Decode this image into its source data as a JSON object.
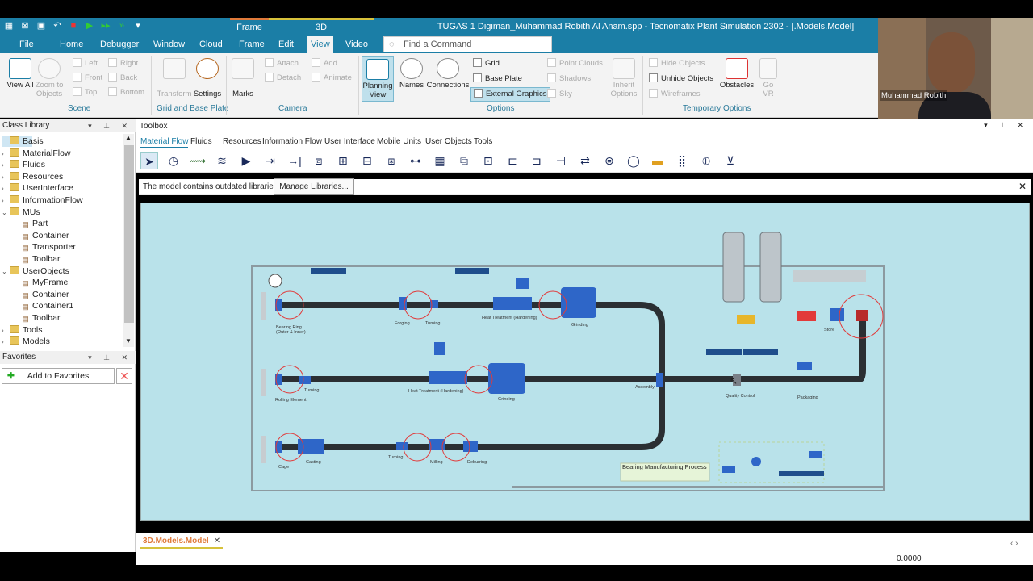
{
  "app": {
    "title": "TUGAS 1 Digiman_Muhammad Robith Al Anam.spp - Tecnomatix Plant Simulation 2302 - [.Models.Model]",
    "context_tabs": [
      "Frame",
      "3D"
    ]
  },
  "menu": [
    "File",
    "Home",
    "Debugger",
    "Window",
    "Cloud",
    "Frame",
    "Edit",
    "View",
    "Video"
  ],
  "active_menu": "View",
  "search": {
    "placeholder": "Find a Command"
  },
  "ribbon": {
    "scene": {
      "label": "Scene",
      "view_all": "View All",
      "zoom_to": "Zoom to Objects",
      "left": "Left",
      "front": "Front",
      "top": "Top",
      "right": "Right",
      "back": "Back",
      "bottom": "Bottom"
    },
    "grid_base": {
      "label": "Grid and Base Plate",
      "transform": "Transform",
      "settings": "Settings"
    },
    "camera": {
      "label": "Camera",
      "marks": "Marks",
      "attach": "Attach",
      "detach": "Detach",
      "add": "Add",
      "animate": "Animate"
    },
    "options": {
      "label": "Options",
      "planning": "Planning View",
      "names": "Names",
      "connections": "Connections",
      "grid": "Grid",
      "base_plate": "Base Plate",
      "external": "External Graphics",
      "point_clouds": "Point Clouds",
      "shadows": "Shadows",
      "sky": "Sky",
      "inherit": "Inherit Options"
    },
    "temporary": {
      "label": "Temporary Options",
      "hide": "Hide Objects",
      "unhide": "Unhide Objects",
      "wireframes": "Wireframes",
      "obstacles": "Obstacles",
      "go_vr": "Go VR"
    }
  },
  "webcam": {
    "name": "Muhammad Robith"
  },
  "class_library": {
    "title": "Class Library",
    "items": [
      {
        "label": "Basis",
        "level": 0,
        "toggle": "",
        "type": "root"
      },
      {
        "label": "MaterialFlow",
        "level": 0,
        "toggle": "›",
        "type": "folder"
      },
      {
        "label": "Fluids",
        "level": 0,
        "toggle": "›",
        "type": "folder"
      },
      {
        "label": "Resources",
        "level": 0,
        "toggle": "›",
        "type": "folder"
      },
      {
        "label": "UserInterface",
        "level": 0,
        "toggle": "›",
        "type": "folder"
      },
      {
        "label": "InformationFlow",
        "level": 0,
        "toggle": "›",
        "type": "folder"
      },
      {
        "label": "MUs",
        "level": 0,
        "toggle": "⌄",
        "type": "folder"
      },
      {
        "label": "Part",
        "level": 1,
        "toggle": "",
        "type": "leaf"
      },
      {
        "label": "Container",
        "level": 1,
        "toggle": "",
        "type": "leaf"
      },
      {
        "label": "Transporter",
        "level": 1,
        "toggle": "",
        "type": "leaf"
      },
      {
        "label": "Toolbar",
        "level": 1,
        "toggle": "",
        "type": "leaf"
      },
      {
        "label": "UserObjects",
        "level": 0,
        "toggle": "⌄",
        "type": "folder"
      },
      {
        "label": "MyFrame",
        "level": 1,
        "toggle": "",
        "type": "leaf"
      },
      {
        "label": "Container",
        "level": 1,
        "toggle": "",
        "type": "leaf"
      },
      {
        "label": "Container1",
        "level": 1,
        "toggle": "",
        "type": "leaf"
      },
      {
        "label": "Toolbar",
        "level": 1,
        "toggle": "",
        "type": "leaf"
      },
      {
        "label": "Tools",
        "level": 0,
        "toggle": "›",
        "type": "folder"
      },
      {
        "label": "Models",
        "level": 0,
        "toggle": "›",
        "type": "folder"
      }
    ]
  },
  "favorites": {
    "title": "Favorites",
    "add": "Add to Favorites"
  },
  "toolbox": {
    "title": "Toolbox",
    "tabs": [
      "Material Flow",
      "Fluids",
      "Resources",
      "Information Flow",
      "User Interface",
      "Mobile Units",
      "User Objects",
      "Tools"
    ],
    "active_tab": "Material Flow"
  },
  "notice": {
    "text": "The model contains outdated libraries.",
    "button": "Manage Libraries..."
  },
  "model": {
    "title": "Bearing Manufacturing Process",
    "labels": {
      "bearing_ring": "Bearing Ring",
      "bearing_ring2": "(Outer & Inner)",
      "forging": "Forging",
      "turning": "Turning",
      "heat_treatment": "Heat Treatment (Hardening)",
      "grinding": "Grinding",
      "rolling": "Rolling Element",
      "cage": "Cage",
      "casting": "Casting",
      "milling": "Milling",
      "deburring": "Deburring",
      "assembly": "Assembly",
      "quality": "Quality Control",
      "packaging": "Packaging",
      "store": "Store"
    }
  },
  "doc_tab": {
    "prefix": "3D",
    "label": ".Models.Model"
  },
  "status": {
    "value": "0.0000"
  },
  "colors": {
    "brand": "#1b7ea6",
    "canvas": "#b9e2ea",
    "conveyor": "#2b2f33",
    "station": "#2e66c8"
  }
}
